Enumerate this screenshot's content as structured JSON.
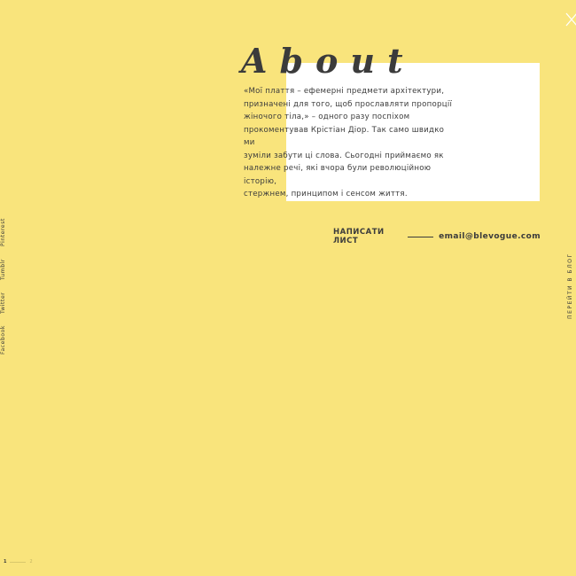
{
  "page": {
    "background_color": "#f9e47c",
    "panel_color": "#ffffff",
    "text_color": "#3b3b3b"
  },
  "header": {
    "title": "About",
    "close_icon": "close-icon"
  },
  "about": {
    "lines": [
      "«Мої плаття – ефемерні предмети архітектури,",
      "призначені для того, щоб прославляти пропорції",
      "жіночого тіла,» – одного разу поспіхом",
      "прокоментував Крістіан Діор. Так само швидко ми",
      "зуміли забути ці слова. Сьогодні приймаємо як",
      "належне речі, які вчора були революційною історію,",
      "стержнем, принципом і сенсом життя."
    ]
  },
  "contact": {
    "write_label": "НАПИСАТИ ЛИСТ",
    "email": "email@blevogue.com"
  },
  "social": {
    "items": [
      "Facebook",
      "Twitter",
      "Tumblr",
      "Pinterest"
    ]
  },
  "blog": {
    "label": "ПЕРЕЙТИ В БЛОГ"
  },
  "pager": {
    "current": "1",
    "total": "2"
  }
}
